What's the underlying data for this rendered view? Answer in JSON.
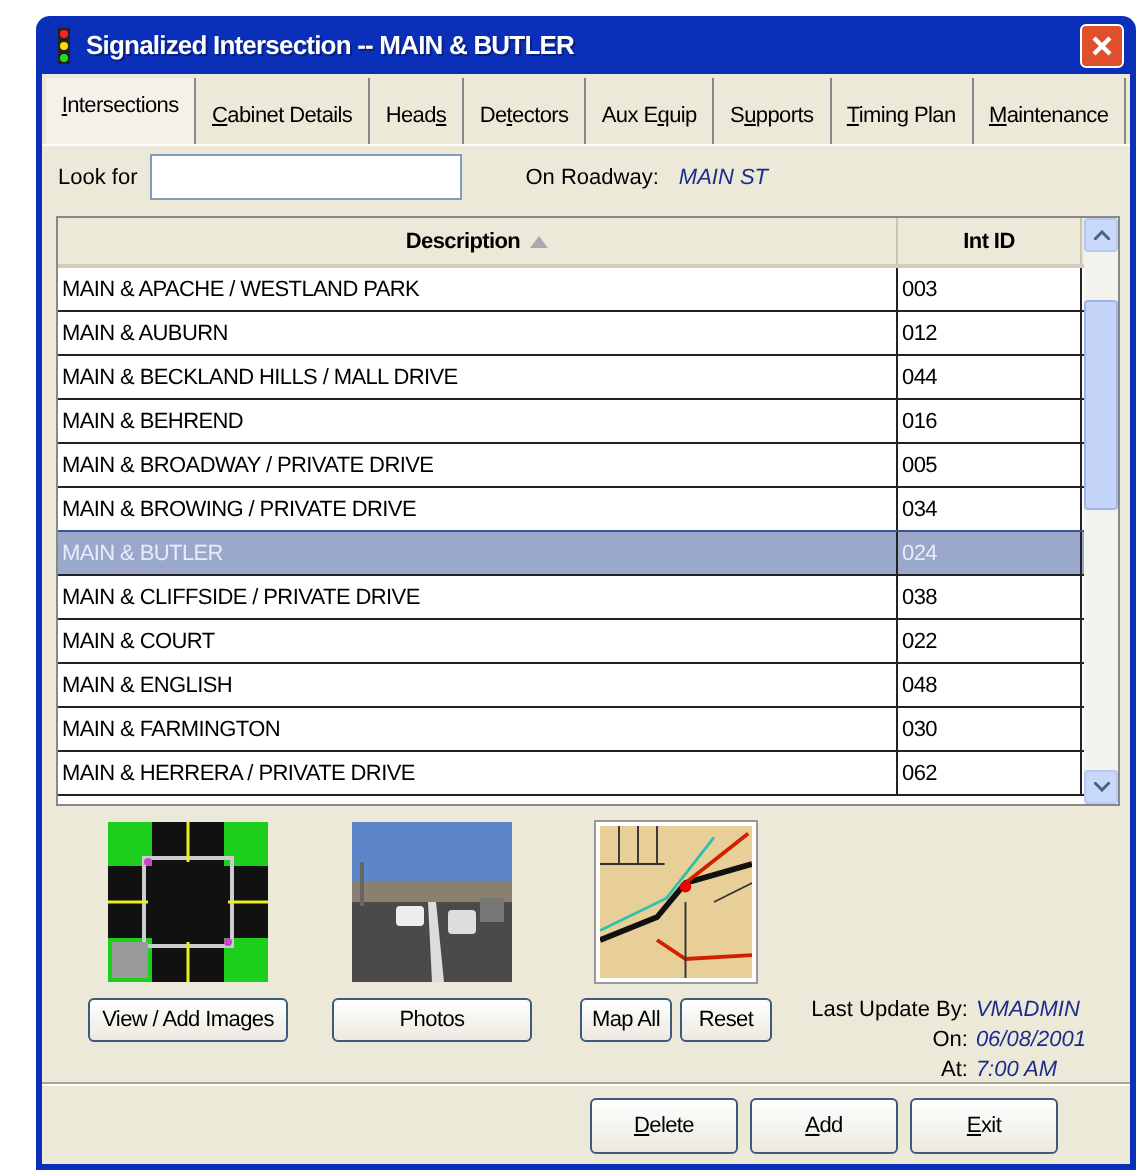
{
  "window": {
    "title": "Signalized Intersection -- MAIN & BUTLER"
  },
  "tabs": [
    {
      "label": {
        "key": "I",
        "post": "ntersections"
      },
      "selected": true
    },
    {
      "label": {
        "key": "C",
        "post": "abinet Details"
      },
      "selected": false
    },
    {
      "label": {
        "pre": "Head",
        "key": "s"
      },
      "selected": false
    },
    {
      "label": {
        "pre": "De",
        "key": "t",
        "post": "ectors"
      },
      "selected": false
    },
    {
      "label": {
        "pre": "Aux E",
        "key": "q",
        "post": "uip"
      },
      "selected": false
    },
    {
      "label": {
        "pre": "S",
        "key": "u",
        "post": "pports"
      },
      "selected": false
    },
    {
      "label": {
        "key": "T",
        "post": "iming Plan"
      },
      "selected": false
    },
    {
      "label": {
        "key": "M",
        "post": "aintenance"
      },
      "selected": false
    }
  ],
  "search": {
    "label": "Look for"
  },
  "roadway": {
    "label": "On Roadway:",
    "value": "MAIN ST"
  },
  "table": {
    "columns": [
      "Description",
      "Int ID"
    ],
    "rows": [
      {
        "description": "MAIN & APACHE / WESTLAND PARK",
        "int_id": "003",
        "selected": false
      },
      {
        "description": "MAIN & AUBURN",
        "int_id": "012",
        "selected": false
      },
      {
        "description": "MAIN & BECKLAND HILLS / MALL DRIVE",
        "int_id": "044",
        "selected": false
      },
      {
        "description": "MAIN & BEHREND",
        "int_id": "016",
        "selected": false
      },
      {
        "description": "MAIN & BROADWAY / PRIVATE DRIVE",
        "int_id": "005",
        "selected": false
      },
      {
        "description": "MAIN & BROWING / PRIVATE DRIVE",
        "int_id": "034",
        "selected": false
      },
      {
        "description": "MAIN & BUTLER",
        "int_id": "024",
        "selected": true
      },
      {
        "description": "MAIN & CLIFFSIDE / PRIVATE DRIVE",
        "int_id": "038",
        "selected": false
      },
      {
        "description": "MAIN & COURT",
        "int_id": "022",
        "selected": false
      },
      {
        "description": "MAIN & ENGLISH",
        "int_id": "048",
        "selected": false
      },
      {
        "description": "MAIN & FARMINGTON",
        "int_id": "030",
        "selected": false
      },
      {
        "description": "MAIN & HERRERA / PRIVATE DRIVE",
        "int_id": "062",
        "selected": false
      }
    ]
  },
  "media": [
    {
      "kind": "diagram",
      "buttons": [
        "View / Add Images"
      ]
    },
    {
      "buttons": [
        "Photos"
      ]
    },
    {
      "kind": "map",
      "buttons": [
        "Map All",
        "Reset"
      ]
    }
  ],
  "update_info": [
    {
      "label": "Last Update By:",
      "value": "VMADMIN"
    },
    {
      "label": "On:",
      "value": "06/08/2001"
    },
    {
      "label": "At:",
      "value": "7:00 AM"
    }
  ],
  "actions": [
    {
      "key": "D",
      "post": "elete"
    },
    {
      "key": "A",
      "post": "dd"
    },
    {
      "key": "E",
      "post": "xit"
    }
  ]
}
